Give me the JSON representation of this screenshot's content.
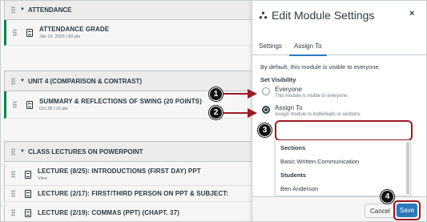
{
  "modules": {
    "headers": [
      {
        "label": "ATTENDANCE"
      },
      {
        "label": "UNIT 4 (COMPARISON & CONTRAST)"
      },
      {
        "label": "CLASS LECTURES ON POWERPOINT"
      }
    ],
    "items": [
      {
        "title": "ATTENDANCE GRADE",
        "meta": "Jan 16, 2025 | 50 pts"
      },
      {
        "title": "SUMMARY & REFLECTIONS OF SWING (20 POINTS)",
        "meta": "Oct 28 | 16 pts"
      },
      {
        "title": "LECTURE (8/25): INTRODUCTIONS (FIRST DAY) PPT",
        "meta": "View"
      },
      {
        "title": "LECTURE (2/17): FIRST/THIRD PERSON ON PPT & SUBJECT:",
        "meta": ""
      },
      {
        "title": "LECTURE (2/19): COMMAS (PPT) (CHAPT. 37)",
        "meta": ""
      }
    ]
  },
  "tray": {
    "title": "Edit Module Settings",
    "close_label": "×",
    "tabs": [
      {
        "label": "Settings"
      },
      {
        "label": "Assign To"
      }
    ],
    "description": "By default, this module is visible to everyone.",
    "set_visibility_label": "Set Visibility",
    "options": [
      {
        "label": "Everyone",
        "sub": "This module is visible to everyone.",
        "checked": false
      },
      {
        "label": "Assign To",
        "sub": "Assign module to individuals or sections.",
        "checked": true
      }
    ],
    "assign_input": {
      "value": "",
      "placeholder": ""
    },
    "dropdown": {
      "sections_heading": "Sections",
      "section_options": [
        "Basic Written Communication"
      ],
      "students_heading": "Students",
      "student_options": [
        "Ben Anderson"
      ]
    },
    "cancel_label": "Cancel",
    "save_label": "Save"
  },
  "annotations": [
    "1",
    "2",
    "3",
    "4"
  ],
  "colors": {
    "accent": "#2b7abc",
    "highlight": "#9c1a25",
    "published": "#0b874b"
  }
}
